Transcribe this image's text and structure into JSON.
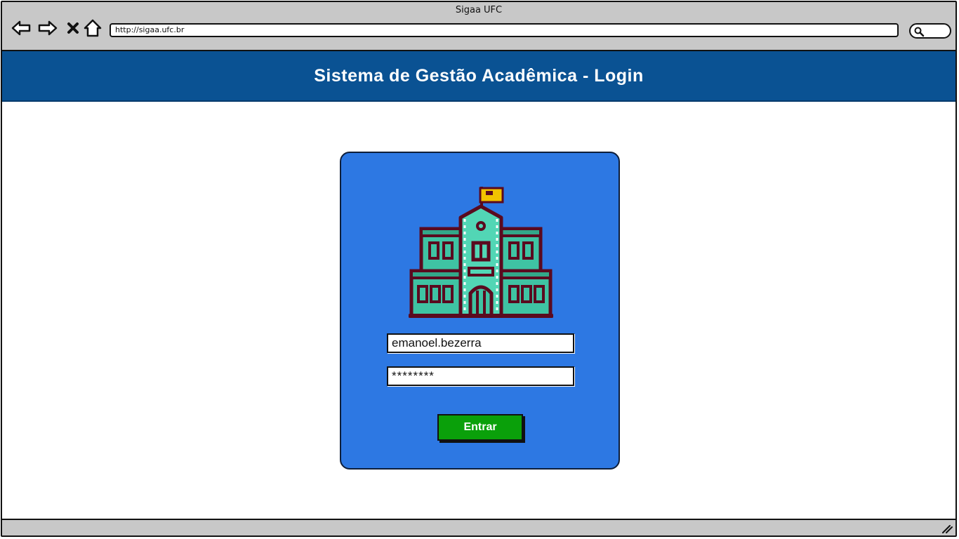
{
  "window": {
    "title": "Sigaa UFC"
  },
  "browser": {
    "url": "http://sigaa.ufc.br",
    "buttons": [
      "back-icon",
      "forward-icon",
      "close-icon",
      "home-icon"
    ],
    "search_icon": "search-icon"
  },
  "header": {
    "title": "Sistema de Gestão Acadêmica - Login"
  },
  "login": {
    "logo_icon": "school-building-icon",
    "username_value": "emanoel.bezerra",
    "password_value": "********",
    "submit_label": "Entrar"
  },
  "colors": {
    "header_bg": "#0a5293",
    "card_bg": "#2d78e3",
    "button_bg": "#0aa00a",
    "chrome_bg": "#c8c8c8"
  }
}
